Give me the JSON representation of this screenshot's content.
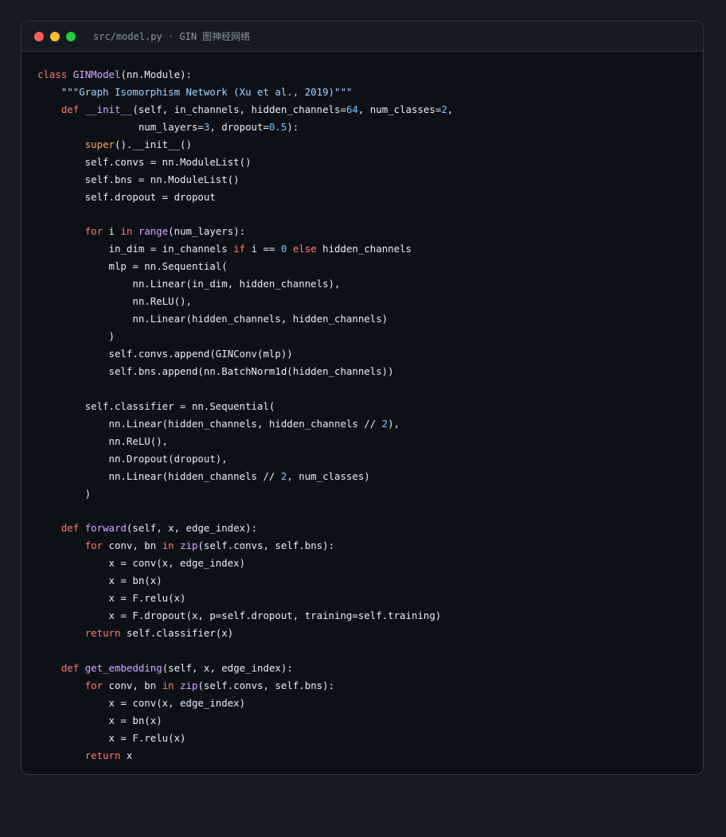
{
  "window": {
    "title": "src/model.py · GIN 图神经网络"
  },
  "code": {
    "language": "python",
    "lines": [
      [
        {
          "t": "class",
          "c": "kw"
        },
        {
          "t": " "
        },
        {
          "t": "GINModel",
          "c": "fn"
        },
        {
          "t": "(nn.Module):"
        }
      ],
      [
        {
          "t": "    "
        },
        {
          "t": "\"\"\"Graph Isomorphism Network (Xu et al., 2019)\"\"\"",
          "c": "str"
        }
      ],
      [
        {
          "t": "    "
        },
        {
          "t": "def",
          "c": "kw"
        },
        {
          "t": " "
        },
        {
          "t": "__init__",
          "c": "fn"
        },
        {
          "t": "(self, in_channels, hidden_channels="
        },
        {
          "t": "64",
          "c": "num"
        },
        {
          "t": ", num_classes="
        },
        {
          "t": "2",
          "c": "num"
        },
        {
          "t": ","
        }
      ],
      [
        {
          "t": "                 num_layers="
        },
        {
          "t": "3",
          "c": "num"
        },
        {
          "t": ", dropout="
        },
        {
          "t": "0.5",
          "c": "num"
        },
        {
          "t": "):"
        }
      ],
      [
        {
          "t": "        "
        },
        {
          "t": "super",
          "c": "bi"
        },
        {
          "t": "().__init__()"
        }
      ],
      [
        {
          "t": "        self.convs = nn.ModuleList()"
        }
      ],
      [
        {
          "t": "        self.bns = nn.ModuleList()"
        }
      ],
      [
        {
          "t": "        self.dropout = dropout"
        }
      ],
      [],
      [
        {
          "t": "        "
        },
        {
          "t": "for",
          "c": "kw"
        },
        {
          "t": " i "
        },
        {
          "t": "in",
          "c": "kw"
        },
        {
          "t": " "
        },
        {
          "t": "range",
          "c": "fn"
        },
        {
          "t": "(num_layers):"
        }
      ],
      [
        {
          "t": "            in_dim = in_channels "
        },
        {
          "t": "if",
          "c": "kw"
        },
        {
          "t": " i == "
        },
        {
          "t": "0",
          "c": "num"
        },
        {
          "t": " "
        },
        {
          "t": "else",
          "c": "kw"
        },
        {
          "t": " hidden_channels"
        }
      ],
      [
        {
          "t": "            mlp = nn.Sequential("
        }
      ],
      [
        {
          "t": "                nn.Linear(in_dim, hidden_channels),"
        }
      ],
      [
        {
          "t": "                nn.ReLU(),"
        }
      ],
      [
        {
          "t": "                nn.Linear(hidden_channels, hidden_channels)"
        }
      ],
      [
        {
          "t": "            )"
        }
      ],
      [
        {
          "t": "            self.convs.append(GINConv(mlp))"
        }
      ],
      [
        {
          "t": "            self.bns.append(nn.BatchNorm1d(hidden_channels))"
        }
      ],
      [],
      [
        {
          "t": "        self.classifier = nn.Sequential("
        }
      ],
      [
        {
          "t": "            nn.Linear(hidden_channels, hidden_channels // "
        },
        {
          "t": "2",
          "c": "num"
        },
        {
          "t": "),"
        }
      ],
      [
        {
          "t": "            nn.ReLU(),"
        }
      ],
      [
        {
          "t": "            nn.Dropout(dropout),"
        }
      ],
      [
        {
          "t": "            nn.Linear(hidden_channels // "
        },
        {
          "t": "2",
          "c": "num"
        },
        {
          "t": ", num_classes)"
        }
      ],
      [
        {
          "t": "        )"
        }
      ],
      [],
      [
        {
          "t": "    "
        },
        {
          "t": "def",
          "c": "kw"
        },
        {
          "t": " "
        },
        {
          "t": "forward",
          "c": "fn"
        },
        {
          "t": "(self, x, edge_index):"
        }
      ],
      [
        {
          "t": "        "
        },
        {
          "t": "for",
          "c": "kw"
        },
        {
          "t": " conv, bn "
        },
        {
          "t": "in",
          "c": "kw"
        },
        {
          "t": " "
        },
        {
          "t": "zip",
          "c": "fn"
        },
        {
          "t": "(self.convs, self.bns):"
        }
      ],
      [
        {
          "t": "            x = conv(x, edge_index)"
        }
      ],
      [
        {
          "t": "            x = bn(x)"
        }
      ],
      [
        {
          "t": "            x = F.relu(x)"
        }
      ],
      [
        {
          "t": "            x = F.dropout(x, p=self.dropout, training=self.training)"
        }
      ],
      [
        {
          "t": "        "
        },
        {
          "t": "return",
          "c": "kw"
        },
        {
          "t": " self.classifier(x)"
        }
      ],
      [],
      [
        {
          "t": "    "
        },
        {
          "t": "def",
          "c": "kw"
        },
        {
          "t": " "
        },
        {
          "t": "get_embedding",
          "c": "fn"
        },
        {
          "t": "(self, x, edge_index):"
        }
      ],
      [
        {
          "t": "        "
        },
        {
          "t": "for",
          "c": "kw"
        },
        {
          "t": " conv, bn "
        },
        {
          "t": "in",
          "c": "kw"
        },
        {
          "t": " "
        },
        {
          "t": "zip",
          "c": "fn"
        },
        {
          "t": "(self.convs, self.bns):"
        }
      ],
      [
        {
          "t": "            x = conv(x, edge_index)"
        }
      ],
      [
        {
          "t": "            x = bn(x)"
        }
      ],
      [
        {
          "t": "            x = F.relu(x)"
        }
      ],
      [
        {
          "t": "        "
        },
        {
          "t": "return",
          "c": "kw"
        },
        {
          "t": " x"
        }
      ]
    ]
  }
}
